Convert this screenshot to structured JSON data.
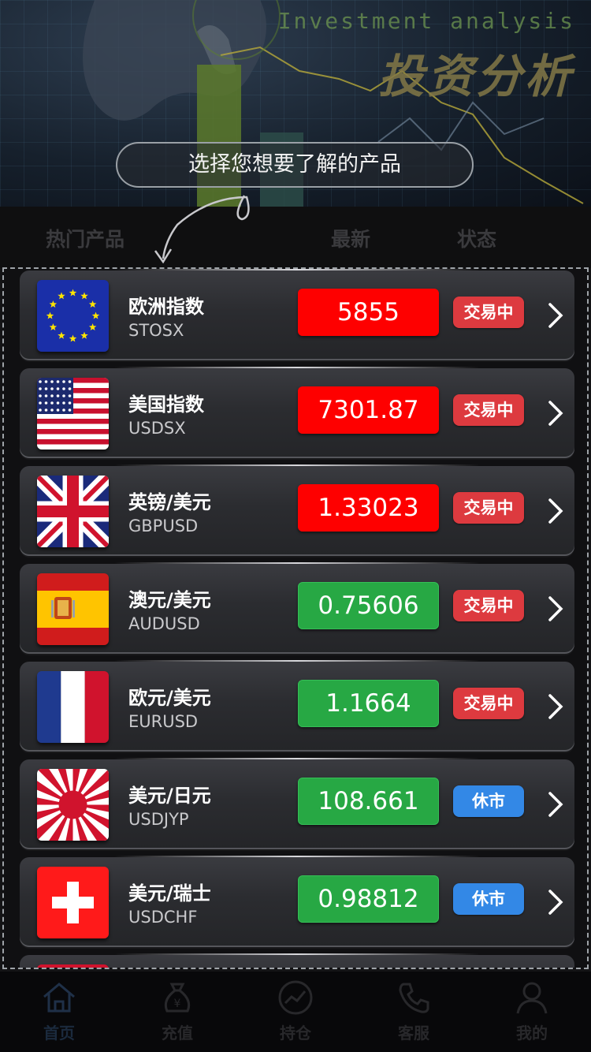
{
  "hero": {
    "english_title": "Investment analysis",
    "chinese_title": "投资分析",
    "hint": "选择您想要了解的产品"
  },
  "table_header": {
    "hot": "热门产品",
    "latest": "最新",
    "status": "状态"
  },
  "colors": {
    "price_up": "#fe0000",
    "price_down": "#27a844",
    "status_open": "#dd3a3f",
    "status_closed": "#3388e6"
  },
  "products": [
    {
      "name": "欧洲指数",
      "code": "STOSX",
      "price": "5855",
      "trend": "up",
      "status": "交易中",
      "state": "open",
      "flag": "eu-flag-icon"
    },
    {
      "name": "美国指数",
      "code": "USDSX",
      "price": "7301.87",
      "trend": "up",
      "status": "交易中",
      "state": "open",
      "flag": "us-flag-icon"
    },
    {
      "name": "英镑/美元",
      "code": "GBPUSD",
      "price": "1.33023",
      "trend": "up",
      "status": "交易中",
      "state": "open",
      "flag": "uk-flag-icon"
    },
    {
      "name": "澳元/美元",
      "code": "AUDUSD",
      "price": "0.75606",
      "trend": "down",
      "status": "交易中",
      "state": "open",
      "flag": "spain-flag-icon"
    },
    {
      "name": "欧元/美元",
      "code": "EURUSD",
      "price": "1.1664",
      "trend": "down",
      "status": "交易中",
      "state": "open",
      "flag": "france-flag-icon"
    },
    {
      "name": "美元/日元",
      "code": "USDJYP",
      "price": "108.661",
      "trend": "down",
      "status": "休市",
      "state": "closed",
      "flag": "rising-sun-flag-icon"
    },
    {
      "name": "美元/瑞士",
      "code": "USDCHF",
      "price": "0.98812",
      "trend": "down",
      "status": "休市",
      "state": "closed",
      "flag": "swiss-flag-icon"
    }
  ],
  "tabs": [
    {
      "label": "首页",
      "icon": "home-icon"
    },
    {
      "label": "充值",
      "icon": "money-bag-icon"
    },
    {
      "label": "持仓",
      "icon": "chart-icon"
    },
    {
      "label": "客服",
      "icon": "phone-icon"
    },
    {
      "label": "我的",
      "icon": "user-icon"
    }
  ]
}
